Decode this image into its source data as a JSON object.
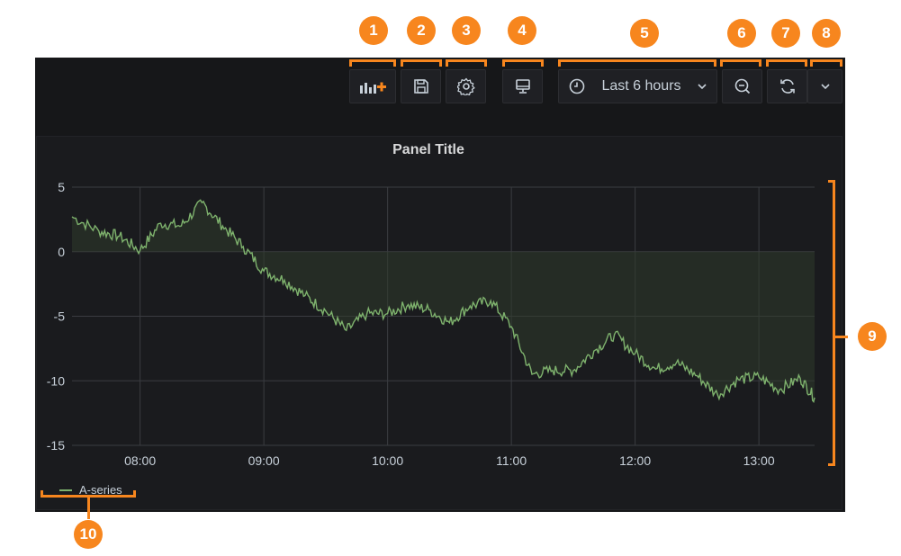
{
  "toolbar": {
    "add_panel_icon": "add-panel-icon",
    "save_icon": "save-icon",
    "settings_icon": "gear-icon",
    "tv_icon": "monitor-icon",
    "time_range_label": "Last 6 hours",
    "zoom_icon": "zoom-out-icon",
    "refresh_icon": "refresh-icon",
    "chevron_icon": "chevron-down-icon"
  },
  "panel": {
    "title": "Panel Title"
  },
  "callouts": [
    "1",
    "2",
    "3",
    "4",
    "5",
    "6",
    "7",
    "8",
    "9",
    "10"
  ],
  "colors": {
    "accent": "#f7861e",
    "series": "#7eb26d",
    "background": "#161719"
  },
  "chart_data": {
    "type": "area",
    "title": "Panel Title",
    "xlabel": "",
    "ylabel": "",
    "x_ticks": [
      "08:00",
      "09:00",
      "10:00",
      "11:00",
      "12:00",
      "13:00"
    ],
    "y_ticks": [
      "5",
      "0",
      "-5",
      "-10",
      "-15"
    ],
    "xlim": [
      "07:27",
      "13:27"
    ],
    "ylim": [
      -15,
      5
    ],
    "grid": true,
    "legend": "bottom-left",
    "series": [
      {
        "name": "A-series",
        "x": [
          "07:27",
          "07:40",
          "07:50",
          "08:00",
          "08:10",
          "08:20",
          "08:30",
          "08:40",
          "08:50",
          "09:00",
          "09:10",
          "09:20",
          "09:30",
          "09:40",
          "09:50",
          "10:00",
          "10:10",
          "10:20",
          "10:30",
          "10:40",
          "10:50",
          "11:00",
          "11:10",
          "11:20",
          "11:30",
          "11:40",
          "11:50",
          "12:00",
          "12:10",
          "12:20",
          "12:30",
          "12:40",
          "12:50",
          "13:00",
          "13:10",
          "13:20",
          "13:27"
        ],
        "values": [
          2.7,
          1.6,
          1.2,
          0.1,
          2.2,
          2.0,
          3.8,
          2.0,
          0.4,
          -1.5,
          -2.2,
          -3.4,
          -4.6,
          -6.1,
          -4.8,
          -4.8,
          -4.1,
          -4.5,
          -5.5,
          -4.2,
          -3.8,
          -5.8,
          -9.5,
          -9.2,
          -9.2,
          -7.7,
          -6.4,
          -7.9,
          -9.1,
          -8.6,
          -9.6,
          -11.1,
          -9.9,
          -9.7,
          -10.7,
          -9.8,
          -11.3
        ]
      }
    ]
  }
}
